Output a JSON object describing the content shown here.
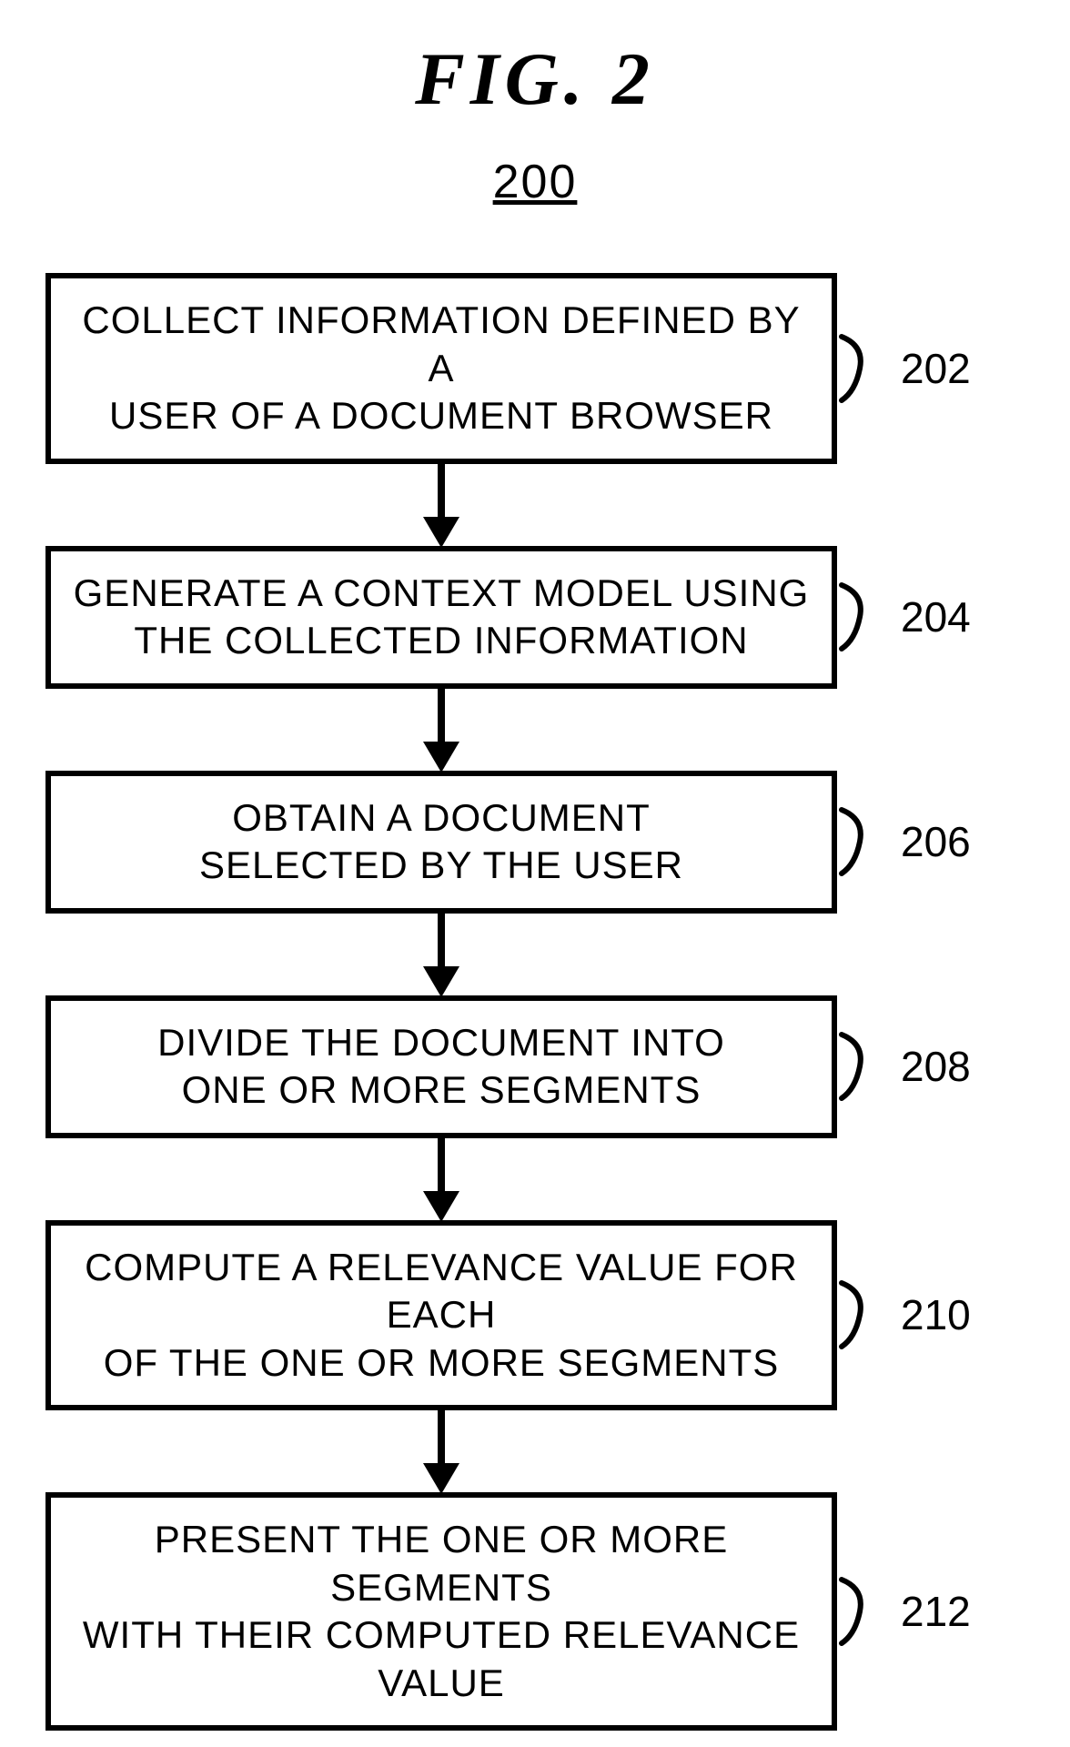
{
  "figure": {
    "title": "FIG.  2",
    "number": "200"
  },
  "steps": [
    {
      "ref": "202",
      "text_l1": "COLLECT INFORMATION DEFINED BY A",
      "text_l2": "USER OF A DOCUMENT BROWSER"
    },
    {
      "ref": "204",
      "text_l1": "GENERATE A CONTEXT MODEL USING",
      "text_l2": "THE COLLECTED INFORMATION"
    },
    {
      "ref": "206",
      "text_l1": "OBTAIN A DOCUMENT",
      "text_l2": "SELECTED BY THE USER"
    },
    {
      "ref": "208",
      "text_l1": "DIVIDE THE DOCUMENT INTO",
      "text_l2": "ONE OR MORE SEGMENTS"
    },
    {
      "ref": "210",
      "text_l1": "COMPUTE A RELEVANCE VALUE FOR EACH",
      "text_l2": "OF THE ONE OR MORE SEGMENTS"
    },
    {
      "ref": "212",
      "text_l1": "PRESENT THE ONE OR MORE SEGMENTS",
      "text_l2": "WITH THEIR COMPUTED RELEVANCE VALUE"
    }
  ]
}
